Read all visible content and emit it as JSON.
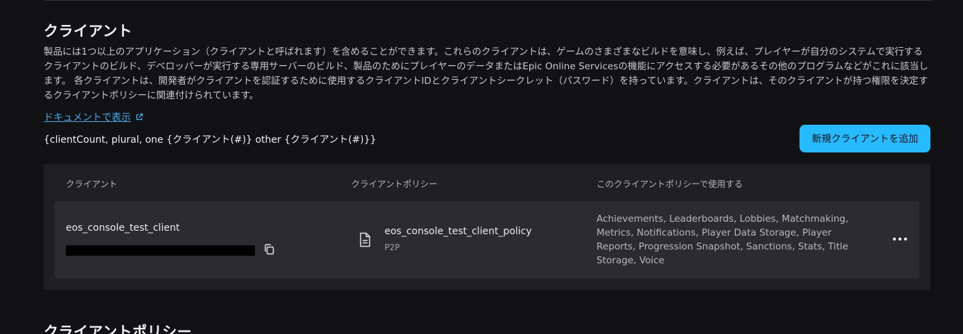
{
  "clients_section": {
    "title": "クライアント",
    "description": "製品には1つ以上のアプリケーション（クライアントと呼ばれます）を含めることができます。これらのクライアントは、ゲームのさまざまなビルドを意味し、例えば、プレイヤーが自分のシステムで実行するクライアントのビルド、デベロッパーが実行する専用サーバーのビルド、製品のためにプレイヤーのデータまたはEpic Online Servicesの機能にアクセスする必要があるその他のプログラムなどがこれに該当します。 各クライアントは、開発者がクライアントを認証するために使用するクライアントIDとクライアントシークレット（パスワード）を持っています。クライアントは、そのクライアントが持つ権限を決定するクライアントポリシーに関連付けられています。",
    "doc_link": "ドキュメントで表示",
    "count_text": "{clientCount, plural, one {クライアント(#)} other {クライアント(#)}}",
    "add_button": "新規クライアントを追加"
  },
  "table": {
    "headers": [
      "クライアント",
      "クライアントポリシー",
      "このクライアントポリシーで使用する"
    ],
    "rows": [
      {
        "client_name": "eos_console_test_client",
        "policy_name": "eos_console_test_client_policy",
        "policy_type": "P2P",
        "features": "Achievements, Leaderboards, Lobbies, Matchmaking, Metrics, Notifications, Player Data Storage, Player Reports, Progression Snapshot, Sanctions, Stats, Title Storage, Voice"
      }
    ]
  },
  "policies_section": {
    "title": "クライアントポリシー"
  },
  "colors": {
    "background": "#121215",
    "accent": "#26bbff",
    "link": "#3ab0ef",
    "table_bg": "#202024",
    "row_bg": "#2c2c30"
  },
  "icons": {
    "external_link": "external-link-icon",
    "copy": "copy-icon",
    "document": "document-icon",
    "more": "more-horizontal-icon"
  }
}
